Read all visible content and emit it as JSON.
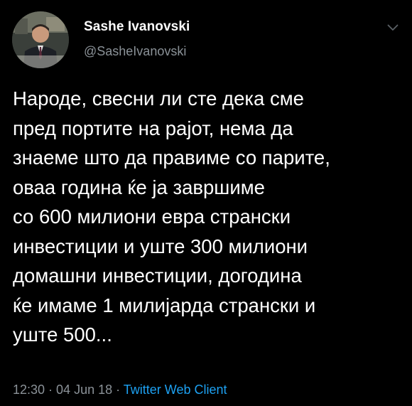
{
  "tweet": {
    "author_name": "Sashe Ivanovski",
    "author_handle": "@SasheIvanovski",
    "text_lines": [
      "Народе, свесни ли сте дека сме",
      "пред портите на рајот, нема да",
      "знаеме што да правиме со парите,",
      "оваа година ќе ја завршиме",
      "со 600 милиони евра странски",
      "инвестиции и уште 300 милиони",
      "домашни инвестиции, догодина",
      "ќе имаме 1 милијарда странски и",
      "уште 500..."
    ],
    "time": "12:30",
    "date": "04 Jun 18",
    "separator": " · ",
    "source": "Twitter Web Client"
  },
  "icons": {
    "avatar": "avatar-photo",
    "menu": "chevron-down-icon"
  },
  "colors": {
    "background": "#000000",
    "text": "#ffffff",
    "secondary": "#8b9298",
    "link": "#1da1f2"
  }
}
